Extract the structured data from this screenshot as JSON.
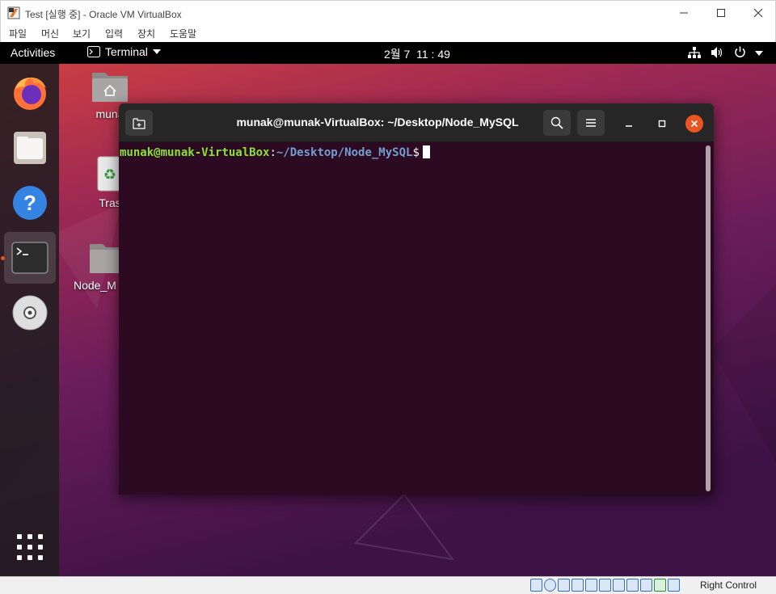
{
  "host_window": {
    "title": "Test [실행 중] - Oracle VM VirtualBox",
    "menu": [
      "파일",
      "머신",
      "보기",
      "입력",
      "장치",
      "도움말"
    ],
    "host_key": "Right Control"
  },
  "top_bar": {
    "activities": "Activities",
    "app_name": "Terminal",
    "clock_date": "2월 7",
    "clock_time": "11 : 49"
  },
  "desktop_icons": [
    {
      "label": "muna"
    },
    {
      "label": "Tras"
    },
    {
      "label": "Node_M"
    }
  ],
  "terminal": {
    "title": "munak@munak-VirtualBox: ~/Desktop/Node_MySQL",
    "prompt_user": "munak@munak-VirtualBox",
    "prompt_colon": ":",
    "prompt_path": "~/Desktop/Node_MySQL",
    "prompt_symbol": "$"
  },
  "colors": {
    "ubuntu_orange": "#e95420",
    "terminal_bg": "#2c0a21",
    "prompt_green": "#8ae234",
    "prompt_blue": "#729fcf"
  }
}
